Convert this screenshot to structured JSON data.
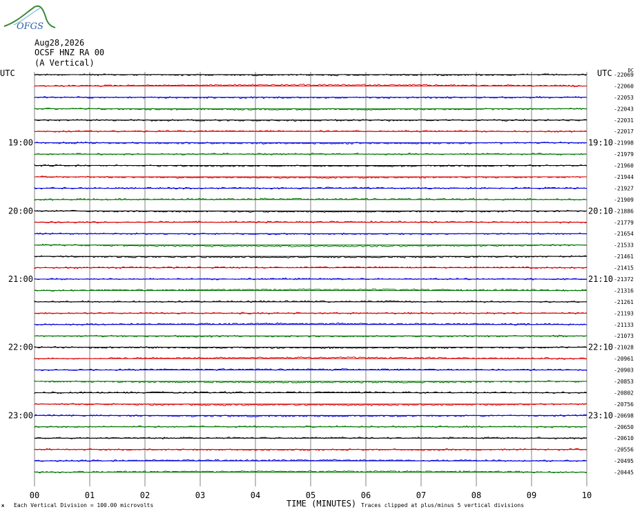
{
  "logo_text": "OFGS",
  "header": {
    "date": "Aug28,2026",
    "station": "OCSF HNZ RA 00",
    "component": "(A Vertical)"
  },
  "left_axis_label": "UTC",
  "right_axis_label": "UTC",
  "right_units": "DC",
  "footer": {
    "scale_mark": "ж",
    "scale_note": "Each Vertical Division = 100.00 microvolts",
    "xlabel": "TIME (MINUTES)",
    "clip_note": "Traces clipped at plus/minus 5 vertical divisions"
  },
  "colors": {
    "trace_cycle": [
      "#000000",
      "#dd0000",
      "#0000dd",
      "#007700"
    ],
    "grid": "#808080",
    "logo": "#3a8a3a"
  },
  "chart_data": {
    "type": "line",
    "title": "",
    "xlabel": "TIME (MINUTES)",
    "x_ticks": [
      "00",
      "01",
      "02",
      "03",
      "04",
      "05",
      "06",
      "07",
      "08",
      "09",
      "10"
    ],
    "xlim": [
      0,
      10
    ],
    "trace_count": 36,
    "minutes_per_trace": 10,
    "left_hour_labels": [
      {
        "trace": 6,
        "label": "19:00"
      },
      {
        "trace": 12,
        "label": "20:00"
      },
      {
        "trace": 18,
        "label": "21:00"
      },
      {
        "trace": 24,
        "label": "22:00"
      },
      {
        "trace": 30,
        "label": "23:00"
      }
    ],
    "right_hour_labels": [
      {
        "trace": 6,
        "label": "19:10"
      },
      {
        "trace": 12,
        "label": "20:10"
      },
      {
        "trace": 18,
        "label": "21:10"
      },
      {
        "trace": 24,
        "label": "22:10"
      },
      {
        "trace": 30,
        "label": "23:10"
      }
    ],
    "dc_offsets": [
      "-22069",
      "-22060",
      "-22053",
      "-22043",
      "-22031",
      "-22017",
      "-21998",
      "-21979",
      "-21960",
      "-21944",
      "-21927",
      "-21909",
      "-21886",
      "-21779",
      "-21654",
      "-21533",
      "-21461",
      "-21415",
      "-21372",
      "-21316",
      "-21261",
      "-21193",
      "-21133",
      "-21073",
      "-21028",
      "-20961",
      "-20903",
      "-20853",
      "-20802",
      "-20756",
      "-20698",
      "-20650",
      "-20610",
      "-20556",
      "-20495",
      "-20445"
    ]
  }
}
